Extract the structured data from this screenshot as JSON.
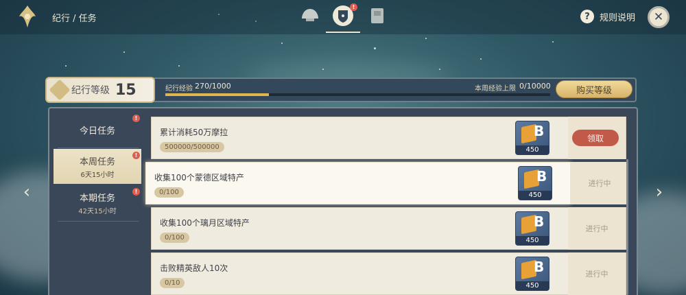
{
  "header": {
    "breadcrumb": "纪行 / 任务",
    "rules_label": "规则说明",
    "alert_mark": "!",
    "tabs": [
      {
        "icon": "shell-icon",
        "active": false
      },
      {
        "icon": "mission-shield-icon",
        "active": true,
        "alert": true
      },
      {
        "icon": "card-icon",
        "active": false
      }
    ]
  },
  "level": {
    "label": "纪行等级",
    "value": "15",
    "exp_label": "纪行经验",
    "exp_value": "270/1000",
    "exp_progress": 0.27,
    "weekly_cap_label": "本周经验上限",
    "weekly_cap_value": "0/10000",
    "buy_label": "购买等级"
  },
  "sidebar": {
    "items": [
      {
        "title": "今日任务",
        "sub": "",
        "active": false,
        "alert": true
      },
      {
        "title": "本周任务",
        "sub": "6天15小时",
        "active": true,
        "alert": true
      },
      {
        "title": "本期任务",
        "sub": "42天15小时",
        "active": false,
        "alert": true
      }
    ]
  },
  "tasks": [
    {
      "title": "累计消耗50万摩拉",
      "progress": "500000/500000",
      "reward_qty": "450",
      "status": "领取",
      "claimable": true
    },
    {
      "title": "收集100个蒙德区域特产",
      "progress": "0/100",
      "reward_qty": "450",
      "status": "进行中",
      "claimable": false
    },
    {
      "title": "收集100个璃月区域特产",
      "progress": "0/100",
      "reward_qty": "450",
      "status": "进行中",
      "claimable": false
    },
    {
      "title": "击败精英敌人10次",
      "progress": "0/10",
      "reward_qty": "450",
      "status": "进行中",
      "claimable": false
    }
  ],
  "reward_glyph": "B",
  "nav": {
    "prev": "‹",
    "next": "›"
  },
  "colors": {
    "accent_gold": "#d8b469",
    "claim_red": "#c25a4a",
    "panel": "#3a4758"
  }
}
